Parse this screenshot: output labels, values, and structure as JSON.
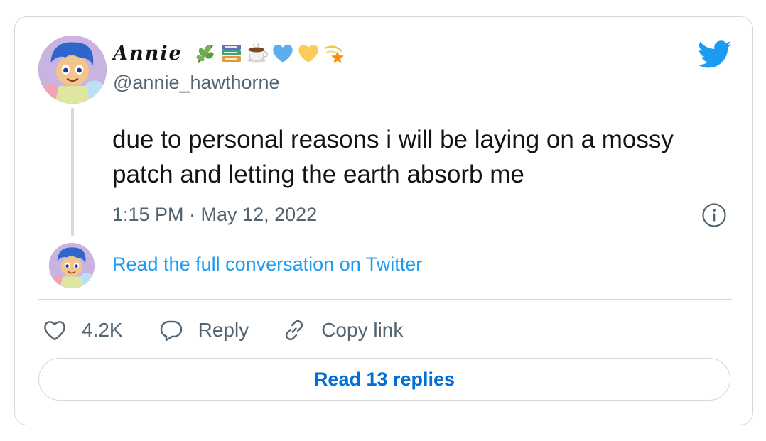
{
  "tweet": {
    "display_name": "Annie",
    "name_emojis": [
      "herb-emoji",
      "books-emoji",
      "hot-beverage-emoji",
      "blue-heart-emoji",
      "yellow-heart-emoji",
      "shooting-star-emoji"
    ],
    "handle": "@annie_hawthorne",
    "text": "due to personal reasons i will be laying on a mossy patch and letting the earth absorb me",
    "timestamp": "1:15 PM · May 12, 2022",
    "full_conversation_link": "Read the full conversation on Twitter",
    "likes": "4.2K",
    "reply_label": "Reply",
    "copy_link_label": "Copy link",
    "read_replies_label": "Read 13 replies"
  },
  "icons": {
    "brand": "twitter-bird-icon",
    "info": "info-icon",
    "like": "heart-icon",
    "reply": "reply-bubble-icon",
    "copy": "link-icon"
  },
  "colors": {
    "brand_blue": "#1d9bf0",
    "link_blue": "#1d9bf0",
    "button_blue": "#006fd6",
    "secondary_text": "#536471",
    "border": "#cfd9de"
  }
}
